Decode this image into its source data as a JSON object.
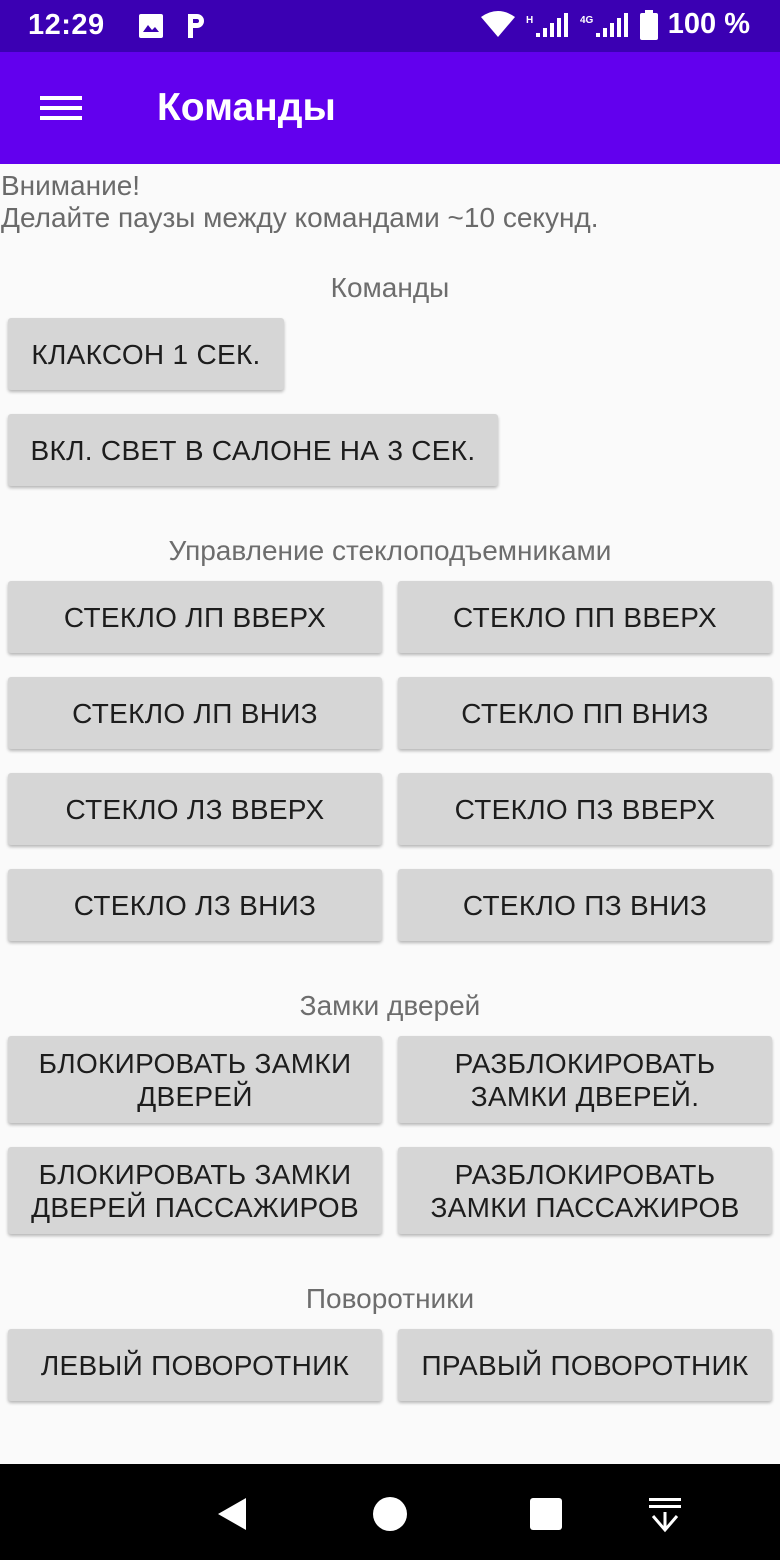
{
  "status_bar": {
    "time": "12:29",
    "battery": "100 %",
    "background": "#3b00b3",
    "icons": [
      "image-icon",
      "parking-icon",
      "wifi-icon",
      "signal-h-icon",
      "signal-4g-icon",
      "battery-icon"
    ]
  },
  "app_bar": {
    "title": "Команды",
    "background": "#6200ee",
    "menu_icon": "hamburger-menu-icon"
  },
  "notice": {
    "line1": "Внимание!",
    "line2": "Делайте паузы между командами ~10 секунд."
  },
  "sections": {
    "commands": {
      "title": "Команды",
      "horn": "КЛАКСОН 1 СЕК.",
      "cabin_light": "ВКЛ. СВЕТ В САЛОНЕ НА 3 СЕК."
    },
    "windows": {
      "title": "Управление стеклоподъемниками",
      "fl_up": "СТЕКЛО ЛП ВВЕРХ",
      "fr_up": "СТЕКЛО ПП ВВЕРХ",
      "fl_down": "СТЕКЛО ЛП ВНИЗ",
      "fr_down": "СТЕКЛО ПП ВНИЗ",
      "rl_up": "СТЕКЛО ЛЗ ВВЕРХ",
      "rr_up": "СТЕКЛО ПЗ ВВЕРХ",
      "rl_down": "СТЕКЛО ЛЗ ВНИЗ",
      "rr_down": "СТЕКЛО ПЗ ВНИЗ"
    },
    "locks": {
      "title": "Замки дверей",
      "lock_doors_l1": "БЛОКИРОВАТЬ ЗАМКИ",
      "lock_doors_l2": "ДВЕРЕЙ",
      "unlock_doors_l1": "РАЗБЛОКИРОВАТЬ",
      "unlock_doors_l2": "ЗАМКИ ДВЕРЕЙ.",
      "lock_pass_l1": "БЛОКИРОВАТЬ ЗАМКИ",
      "lock_pass_l2": "ДВЕРЕЙ ПАССАЖИРОВ",
      "unlock_pass_l1": "РАЗБЛОКИРОВАТЬ",
      "unlock_pass_l2": "ЗАМКИ ПАССАЖИРОВ"
    },
    "turn_signals": {
      "title": "Поворотники",
      "left": "ЛЕВЫЙ ПОВОРОТНИК",
      "right": "ПРАВЫЙ ПОВОРОТНИК"
    }
  },
  "nav_bar": {
    "icons": [
      "back-icon",
      "home-icon",
      "recents-icon",
      "notification-pulldown-icon"
    ]
  }
}
